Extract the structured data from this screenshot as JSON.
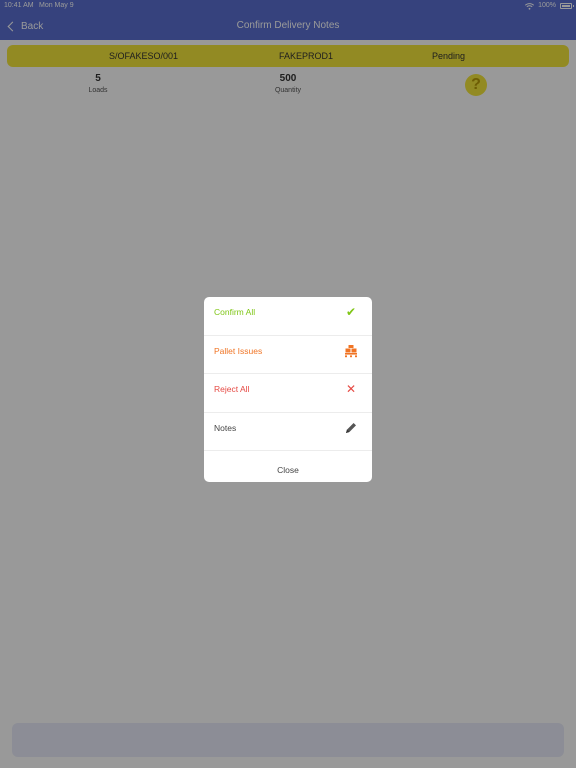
{
  "status_bar": {
    "time": "10:41 AM",
    "date": "Mon May 9",
    "battery": "100%",
    "icons": [
      "wifi-icon",
      "battery-icon"
    ]
  },
  "nav": {
    "back_label": "Back",
    "title": "Confirm Delivery Notes"
  },
  "order": {
    "code": "S/OFAKESO/001",
    "product": "FAKEPROD1",
    "status": "Pending",
    "banner_color": "#f4e73b"
  },
  "stats": {
    "loads": {
      "value": "5",
      "label": "Loads"
    },
    "quantity": {
      "value": "500",
      "label": "Quantity"
    }
  },
  "help": {
    "icon": "help-icon",
    "glyph": "?"
  },
  "action_sheet": {
    "items": [
      {
        "label": "Confirm All",
        "icon": "checkmark-icon",
        "color": "#7fc616"
      },
      {
        "label": "Pallet Issues",
        "icon": "pallet-icon",
        "color": "#f07424"
      },
      {
        "label": "Reject All",
        "icon": "close-icon",
        "color": "#e64a44"
      },
      {
        "label": "Notes",
        "icon": "pencil-icon",
        "color": "#444444"
      }
    ],
    "close_label": "Close"
  },
  "colors": {
    "nav_background": "#5a6fd1",
    "overlay": "rgba(0,0,0,0.4)"
  }
}
